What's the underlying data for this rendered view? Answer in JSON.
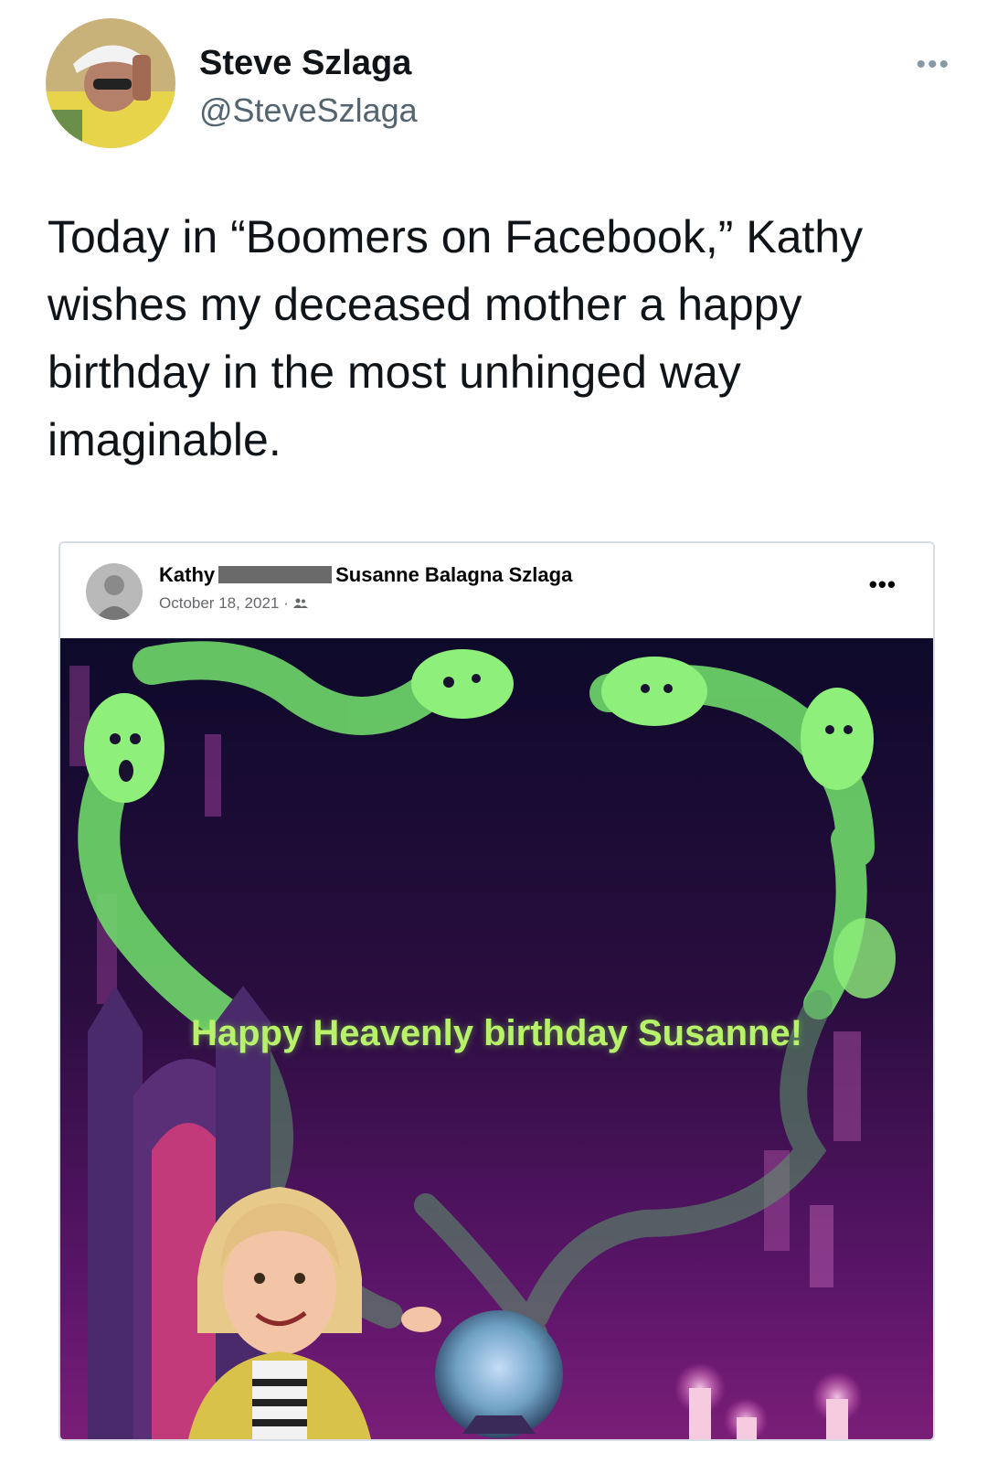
{
  "tweet": {
    "display_name": "Steve Szlaga",
    "handle": "@SteveSzlaga",
    "more_icon": "more-horizontal-icon",
    "text": "Today in “Boomers on Facebook,” Kathy wishes my deceased mother a happy birthday in the most unhinged way imaginable."
  },
  "facebook_post": {
    "author": "Kathy",
    "tagged": "Susanne Balagna Szlaga",
    "date": "October 18, 2021",
    "separator": "·",
    "audience_icon": "friends-icon",
    "more_icon": "more-horizontal-icon",
    "image_caption": "Happy Heavenly birthday Susanne!"
  },
  "colors": {
    "ghost_green": "#7fe36a",
    "background_purple": "#3a0f4d",
    "caption_green": "#b7f26a"
  }
}
